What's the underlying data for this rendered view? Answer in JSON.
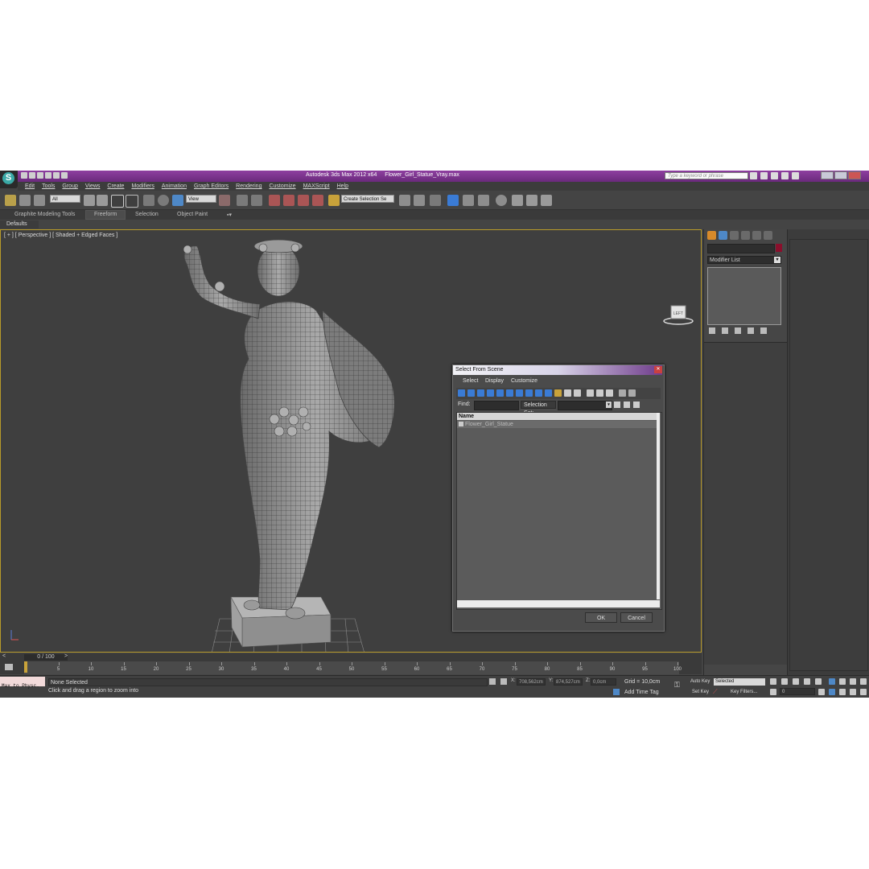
{
  "titlebar": {
    "app_title": "Autodesk 3ds Max  2012 x64",
    "file_name": "Flower_Girl_Statue_Vray.max",
    "search_placeholder": "Type a keyword or phrase"
  },
  "menubar": [
    "Edit",
    "Tools",
    "Group",
    "Views",
    "Create",
    "Modifiers",
    "Animation",
    "Graph Editors",
    "Rendering",
    "Customize",
    "MAXScript",
    "Help"
  ],
  "toolbar": {
    "selection_filter": "All",
    "reference_coord": "View",
    "named_selection": "Create Selection Se"
  },
  "ribbon": {
    "tabs": [
      "Graphite Modeling Tools",
      "Freeform",
      "Selection",
      "Object Paint"
    ],
    "active_tab": "Freeform"
  },
  "ribbon_panel": "Defaults",
  "viewport": {
    "label": "[ + ] [ Perspective ] [ Shaded + Edged Faces ]",
    "viewcube_label": "LEFT"
  },
  "command_panel": {
    "modifier_list": "Modifier List",
    "object_color": "#8a0f2c"
  },
  "dialog": {
    "title": "Select From Scene",
    "menus": [
      "Select",
      "Display",
      "Customize"
    ],
    "find_label": "Find:",
    "selection_set_label": "Selection Set:",
    "column_name": "Name",
    "items": [
      "Flower_Girl_Statue"
    ],
    "ok": "OK",
    "cancel": "Cancel"
  },
  "timeline": {
    "slider": "0 / 100",
    "ticks": [
      "0",
      "5",
      "10",
      "15",
      "20",
      "25",
      "30",
      "35",
      "40",
      "45",
      "50",
      "55",
      "60",
      "65",
      "70",
      "75",
      "80",
      "85",
      "90",
      "95",
      "100"
    ]
  },
  "status": {
    "maxscript": "Max to Physc.",
    "selection": "None Selected",
    "prompt": "Click and drag a region to zoom into",
    "x_label": "X:",
    "x_value": "708,562cm",
    "y_label": "Y:",
    "y_value": "874,527cm",
    "z_label": "Z:",
    "z_value": "0,0cm",
    "grid": "Grid = 10,0cm",
    "add_time_tag": "Add Time Tag",
    "auto_key": "Auto Key",
    "set_key": "Set Key",
    "selected": "Selected",
    "key_filters": "Key Filters...",
    "frame": "0"
  },
  "colors": {
    "title_bar": "#7a3390",
    "viewport_border": "#b89b2a",
    "toolbar_highlight": "#3a7bd5"
  }
}
